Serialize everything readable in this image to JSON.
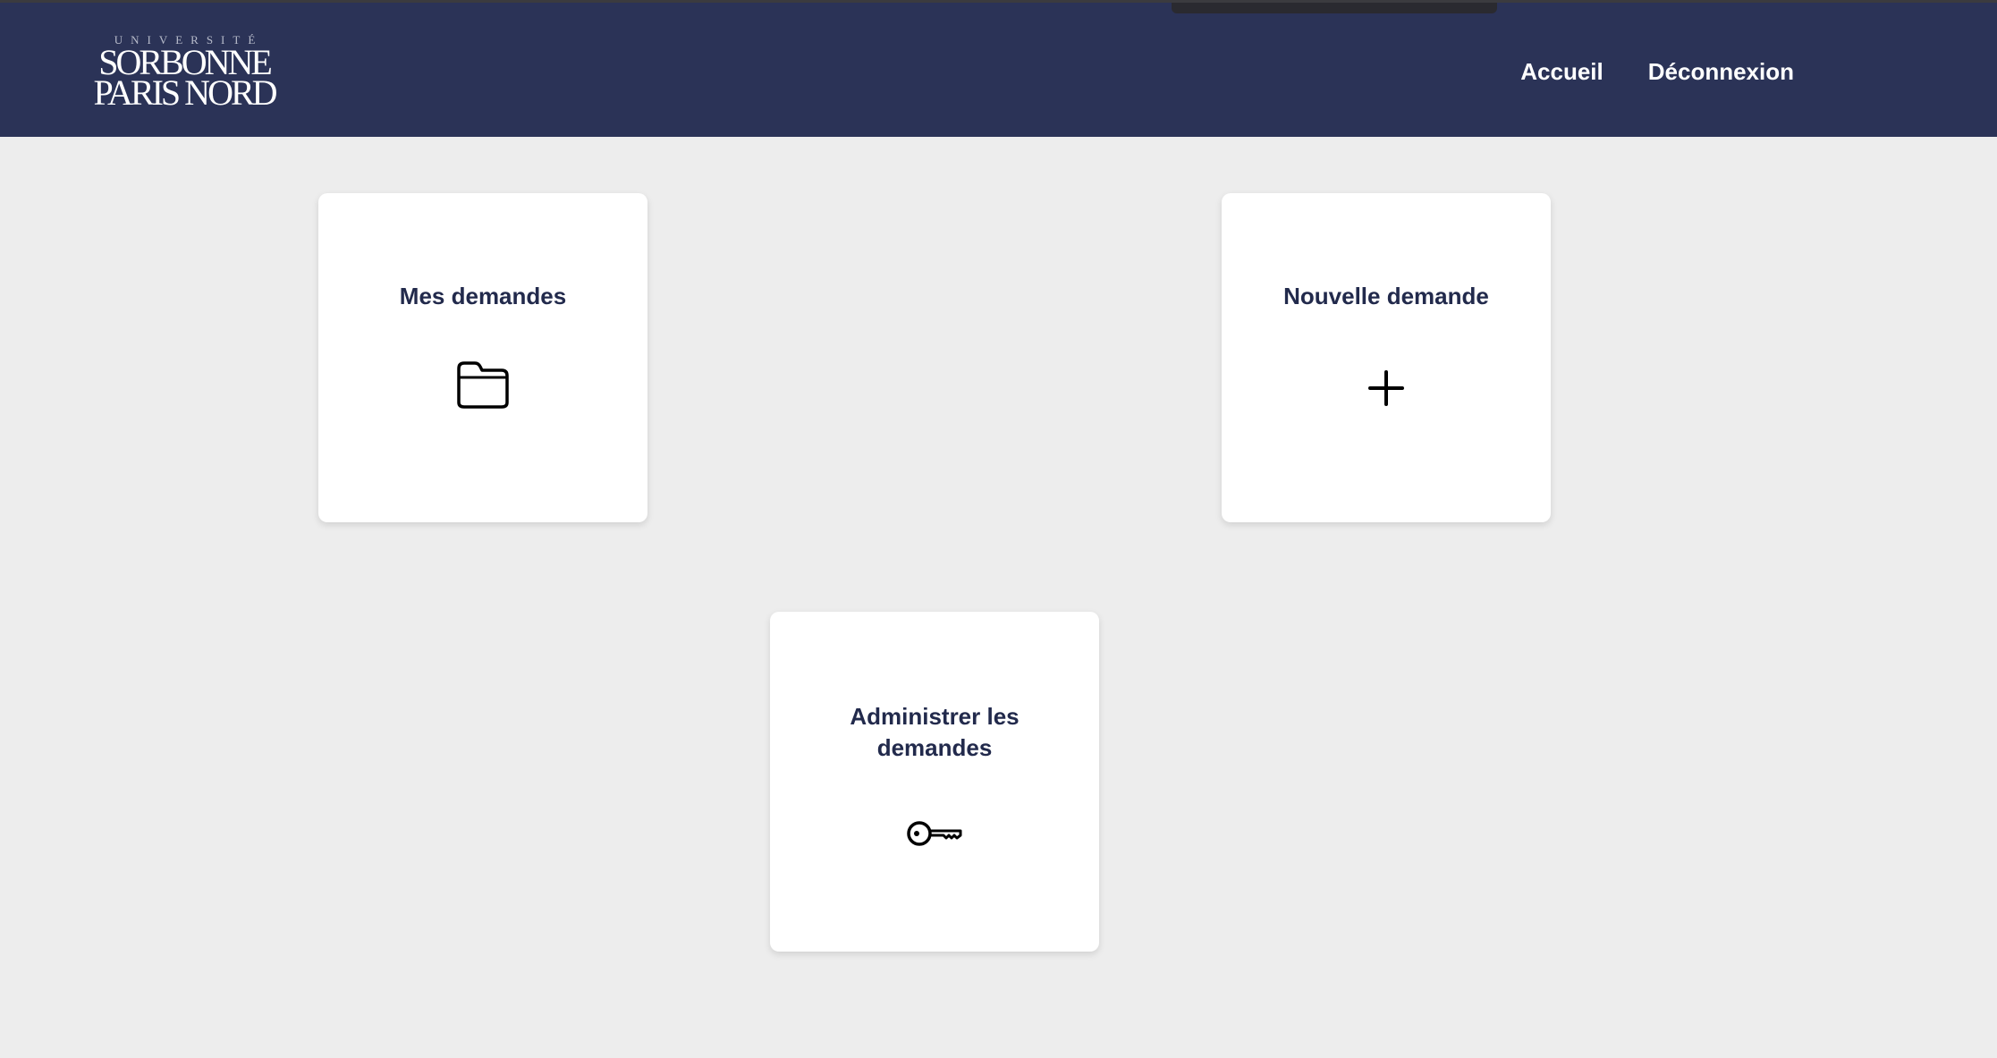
{
  "header": {
    "logo": {
      "line_top": "UNIVERSITÉ",
      "line_1": "SORBONNE",
      "line_2": "PARIS NORD"
    },
    "nav": {
      "home": "Accueil",
      "logout": "Déconnexion"
    }
  },
  "cards": {
    "my_requests": {
      "label": "Mes demandes",
      "icon": "folder-icon"
    },
    "new_request": {
      "label": "Nouvelle demande",
      "icon": "plus-icon"
    },
    "admin_requests": {
      "label": "Administrer les demandes",
      "icon": "key-icon"
    }
  },
  "colors": {
    "header_bg": "#2b3357",
    "page_bg": "#ededed",
    "card_text": "#222a4c"
  }
}
